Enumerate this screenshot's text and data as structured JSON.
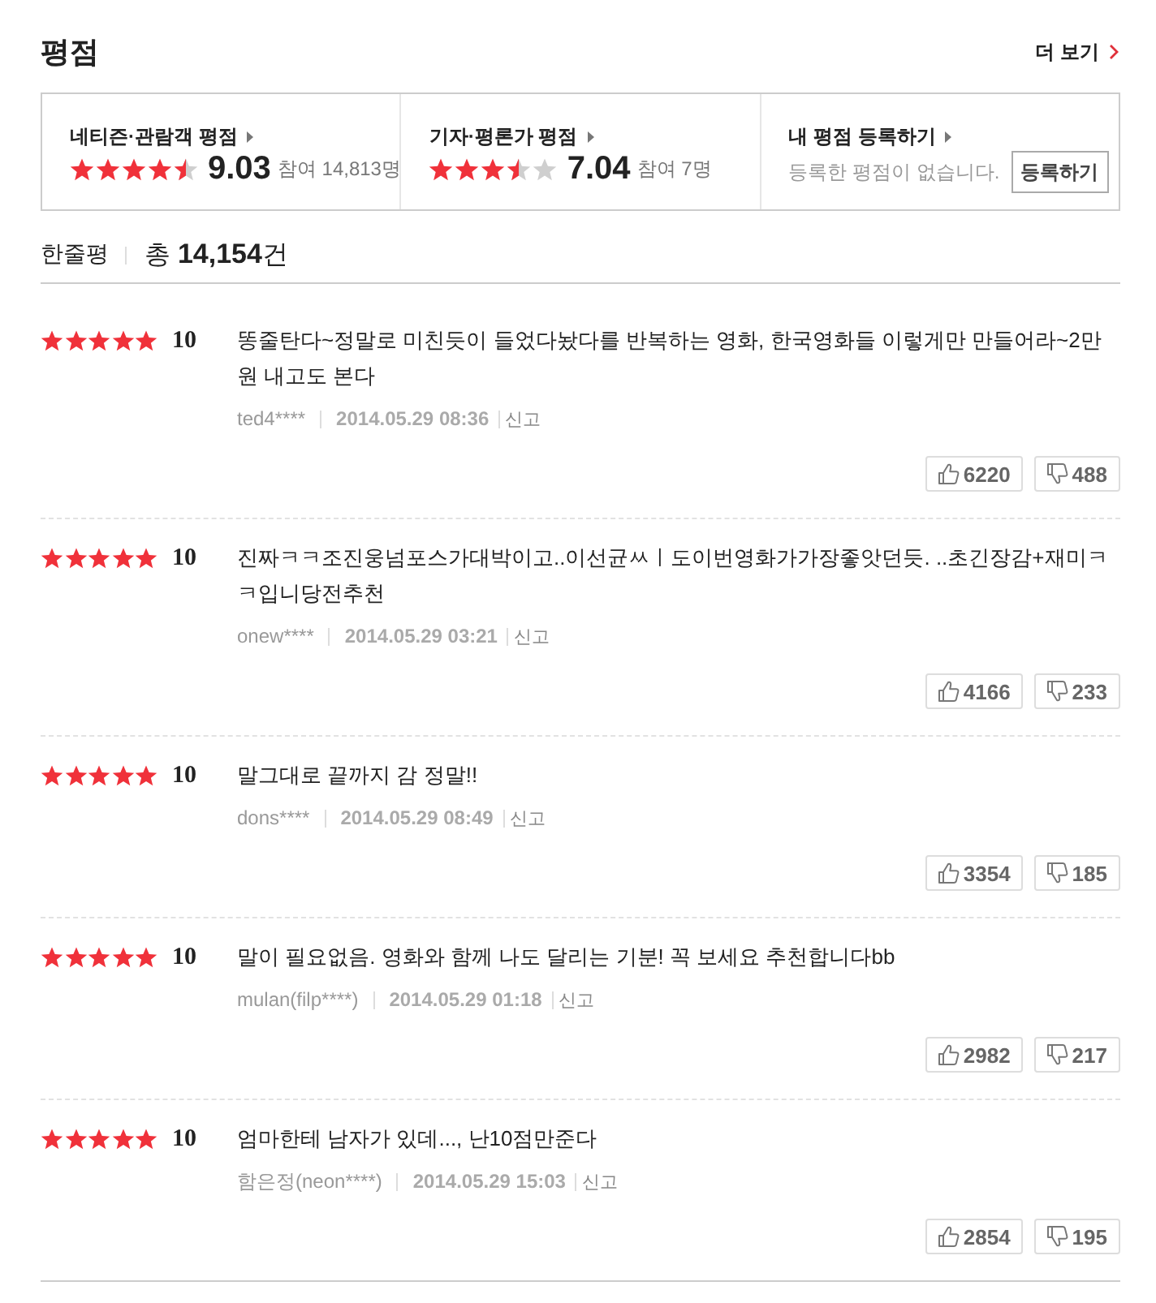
{
  "header": {
    "title": "평점",
    "more_link": "더 보기"
  },
  "summary": [
    {
      "kind": "score",
      "label": "네티즌·관람객 평점",
      "stars": 4.5,
      "score": "9.03",
      "participants": "참여 14,813명"
    },
    {
      "kind": "score",
      "label": "기자·평론가 평점",
      "stars": 3.5,
      "score": "7.04",
      "participants": "참여 7명"
    },
    {
      "kind": "register",
      "label": "내 평점 등록하기",
      "message": "등록한 평점이 없습니다.",
      "button": "등록하기"
    }
  ],
  "review_list": {
    "title": "한줄평",
    "count": "총 **14,154**건"
  },
  "reviews": [
    {
      "stars": 5,
      "score": "10",
      "text": "똥줄탄다~정말로 미친듯이 들었다놨다를 반복하는 영화, 한국영화들 이렇게만 만들어라~2만원 내고도 본다",
      "author": "ted4****",
      "date": "2014.05.29 08:36",
      "report": "신고",
      "likes": "6220",
      "dislikes": "488"
    },
    {
      "stars": 5,
      "score": "10",
      "text": "진짜ㅋㅋ조진웅넘포스가대박이고..이선균ㅆㅣ도이번영화가가장좋앗던듯. ..초긴장감+재미ㅋㅋ입니당전추천",
      "author": "onew****",
      "date": "2014.05.29 03:21",
      "report": "신고",
      "likes": "4166",
      "dislikes": "233"
    },
    {
      "stars": 5,
      "score": "10",
      "text": "말그대로 끝까지 감 정말!!",
      "author": "dons****",
      "date": "2014.05.29 08:49",
      "report": "신고",
      "likes": "3354",
      "dislikes": "185"
    },
    {
      "stars": 5,
      "score": "10",
      "text": "말이 필요없음. 영화와 함께 나도 달리는 기분! 꼭 보세요 추천합니다bb",
      "author": "mulan(filp****)",
      "date": "2014.05.29 01:18",
      "report": "신고",
      "likes": "2982",
      "dislikes": "217"
    },
    {
      "stars": 5,
      "score": "10",
      "text": "엄마한테 남자가 있데..., 난10점만준다",
      "author": "함은정(neon****)",
      "date": "2014.05.29 15:03",
      "report": "신고",
      "likes": "2854",
      "dislikes": "195"
    }
  ]
}
